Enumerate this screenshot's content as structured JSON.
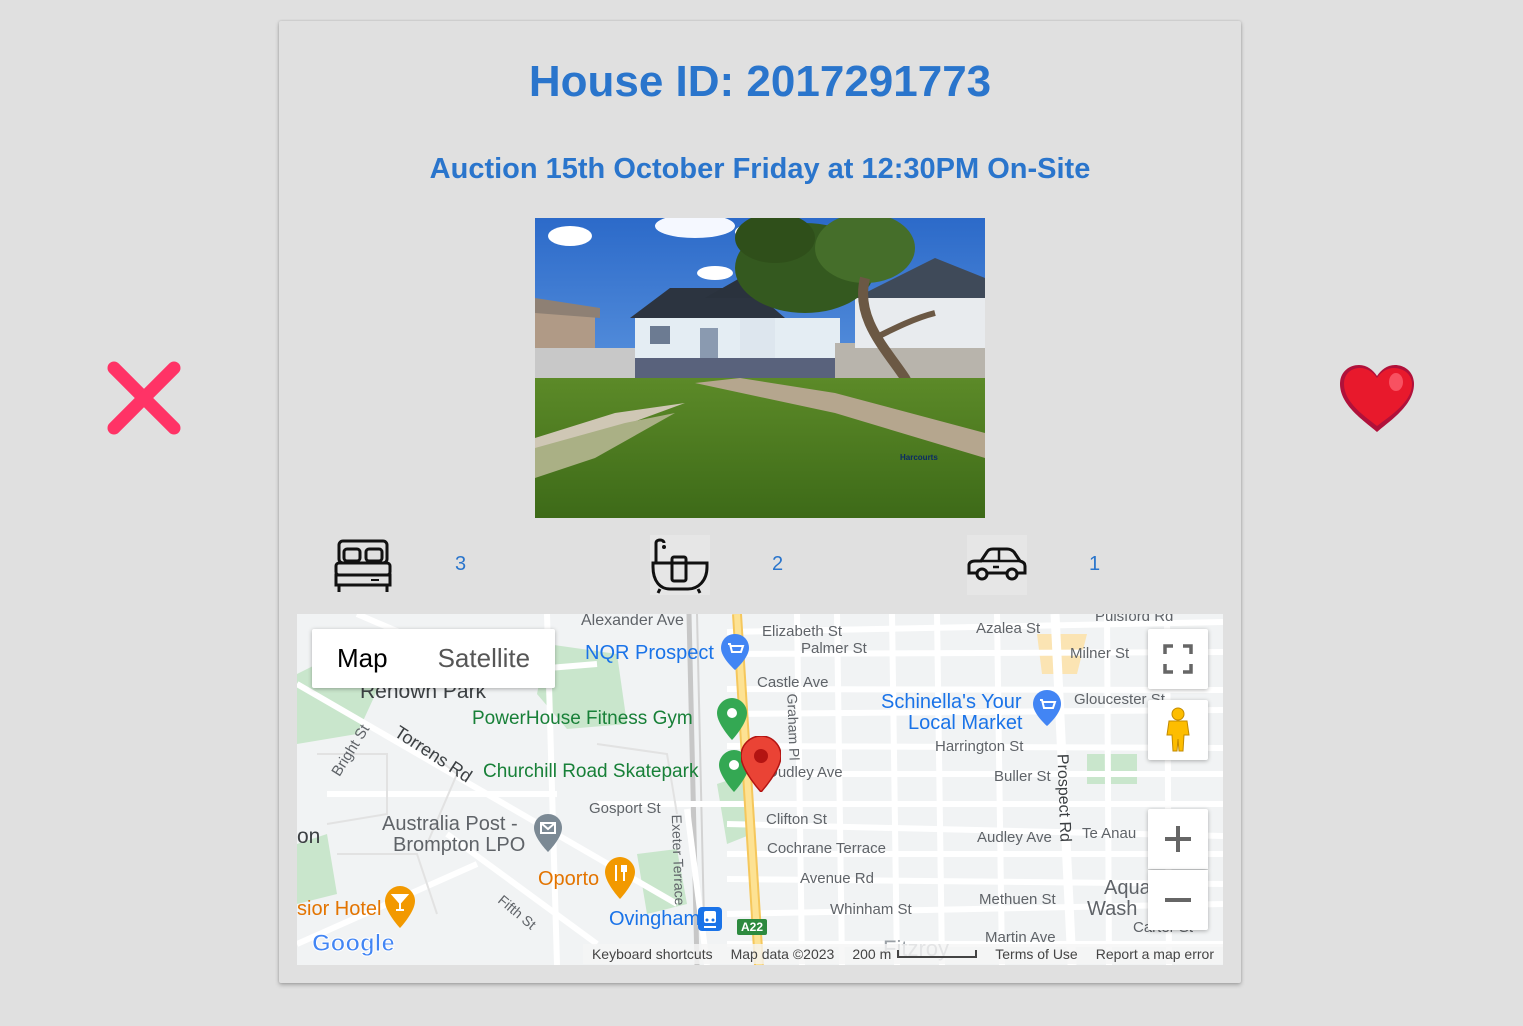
{
  "listing": {
    "title": "House ID: 2017291773",
    "auction": "Auction 15th October Friday at 12:30PM On-Site",
    "photo_watermark": "Harcourts"
  },
  "features": {
    "bedrooms": "3",
    "bathrooms": "2",
    "parking": "1"
  },
  "actions": {
    "reject_icon": "close-x-icon",
    "like_icon": "heart-icon",
    "reject_color": "#ff3366",
    "like_color": "#e8192c"
  },
  "map": {
    "type_map": "Map",
    "type_satellite": "Satellite",
    "labels": {
      "alexander_ave": "Alexander Ave",
      "elizabeth_st": "Elizabeth St",
      "azalea_st": "Azalea St",
      "pulsford_rd": "Pulsford Rd",
      "palmer_st": "Palmer St",
      "milner_st": "Milner St",
      "renown_park": "Renown Park",
      "castle_ave": "Castle Ave",
      "gloucester_st": "Gloucester St",
      "harrington_st": "Harrington St",
      "bright_st": "Bright St",
      "torrens_rd": "Torrens Rd",
      "dudley_ave": "Dudley Ave",
      "buller_st": "Buller St",
      "prospect_rd": "Prospect Rd",
      "gosport_st": "Gosport St",
      "clifton_st": "Clifton St",
      "exeter_terrace": "Exeter Terrace",
      "graham_pl": "Graham Pl",
      "audley_ave": "Audley Ave",
      "te_anau": "Te Anau",
      "cochrane_terrace": "Cochrane Terrace",
      "avenue_rd": "Avenue Rd",
      "whinham_st": "Whinham St",
      "methuen_st": "Methuen St",
      "fifth_st": "Fifth St",
      "martin_ave": "Martin Ave",
      "carter_st": "Carter St",
      "fitzroy": "Fitzroy",
      "on": "on",
      "a22": "A22"
    },
    "places": {
      "nqr": "NQR Prospect",
      "powerhouse": "PowerHouse Fitness Gym",
      "skatepark": "Churchill Road Skatepark",
      "schinella_1": "Schinella's Your",
      "schinella_2": "Local Market",
      "auspost_1": "Australia Post -",
      "auspost_2": "Brompton LPO",
      "oporto": "Oporto",
      "hotel": "sior Hotel",
      "ovingham": "Ovingham",
      "aqua_1": "Aqua",
      "aqua_2": "Wash"
    },
    "footer": {
      "keyboard": "Keyboard shortcuts",
      "mapdata": "Map data ©2023",
      "scale": "200 m",
      "terms": "Terms of Use",
      "report": "Report a map error"
    },
    "logo": "Google"
  }
}
